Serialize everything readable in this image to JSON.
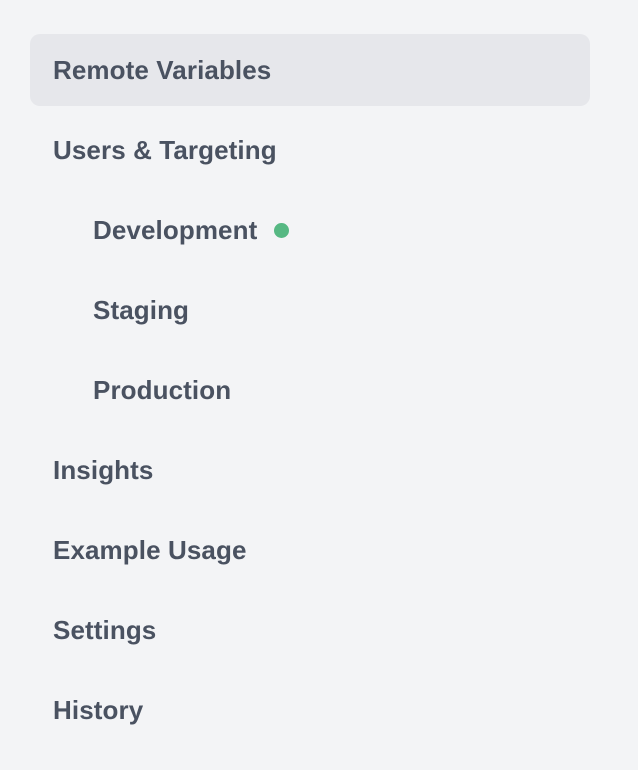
{
  "sidebar": {
    "items": [
      {
        "label": "Remote Variables",
        "active": true
      },
      {
        "label": "Users & Targeting"
      },
      {
        "label": "Development",
        "status_color": "#56b883"
      },
      {
        "label": "Staging"
      },
      {
        "label": "Production"
      },
      {
        "label": "Insights"
      },
      {
        "label": "Example Usage"
      },
      {
        "label": "Settings"
      },
      {
        "label": "History"
      }
    ]
  },
  "colors": {
    "background": "#f3f4f6",
    "active_background": "#e6e7eb",
    "text": "#4a5261",
    "status_online": "#56b883"
  }
}
